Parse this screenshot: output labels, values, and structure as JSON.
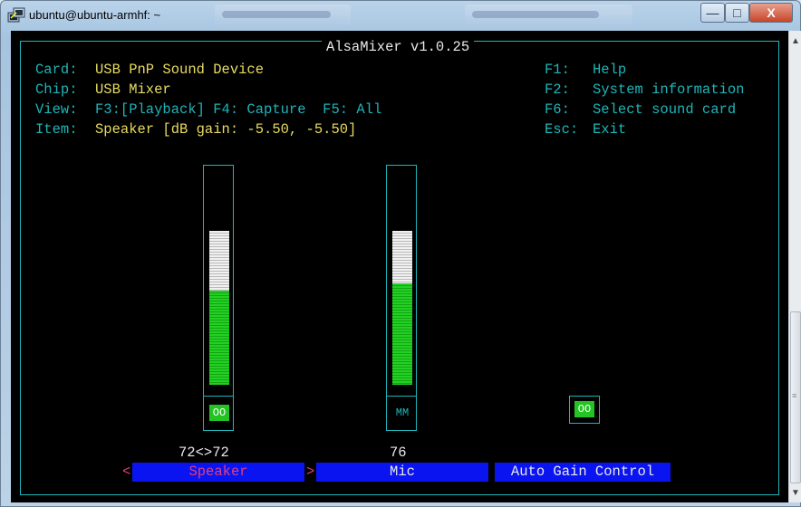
{
  "window": {
    "title": "ubuntu@ubuntu-armhf: ~",
    "buttons": {
      "minimize": "—",
      "maximize": "□",
      "close": "X"
    }
  },
  "mixer": {
    "title": "AlsaMixer v1.0.25",
    "info": [
      {
        "key": "Card:",
        "value": "USB PnP Sound Device"
      },
      {
        "key": "Chip:",
        "value": "USB Mixer"
      },
      {
        "key": "View:",
        "value": "F3:[Playback] F4: Capture  F5: All"
      },
      {
        "key": "Item:",
        "value": "Speaker [dB gain: -5.50, -5.50]"
      }
    ],
    "help": [
      {
        "key": "F1:",
        "value": "Help"
      },
      {
        "key": "F2:",
        "value": "System information"
      },
      {
        "key": "F6:",
        "value": "Select sound card"
      },
      {
        "key": "Esc:",
        "value": "Exit"
      }
    ],
    "channels": [
      {
        "name": "Speaker",
        "value_text": "72<>72",
        "level": 0.72,
        "switch": "OO",
        "selected": true
      },
      {
        "name": "Mic",
        "value_text": "76",
        "level": 0.76,
        "switch": "MM",
        "selected": false
      },
      {
        "name": "Auto Gain Control",
        "value_text": "",
        "switch": "OO",
        "selected": false
      }
    ],
    "selector_left": "<",
    "selector_right": ">"
  },
  "colors": {
    "cyan": "#1fb5b8",
    "yellow": "#e8dc60",
    "green": "#22c322",
    "blue": "#0a14f0",
    "pink": "#e23f7a"
  },
  "icons": {
    "app": "putty-icon",
    "scroll_up": "scroll-up-icon",
    "scroll_down": "scroll-down-icon"
  }
}
